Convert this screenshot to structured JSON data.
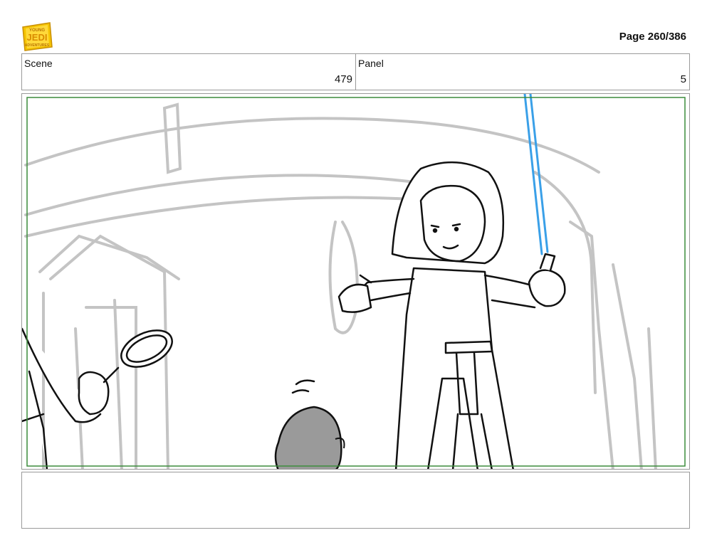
{
  "header": {
    "logo": {
      "icon": "young-jedi-adventures-logo-icon",
      "lines": [
        "YOUNG",
        "JEDI",
        "ADVENTURES"
      ],
      "color": "#f2c200"
    },
    "page_number": "Page 260/386"
  },
  "info": {
    "scene_label": "Scene",
    "scene_value": "479",
    "panel_label": "Panel",
    "panel_value": "5"
  },
  "panel": {
    "description_icons": [
      "sketch-drawing"
    ],
    "safe_frame_color": "#3c8c3c",
    "saber_color": "#3aa0e8"
  },
  "notes": {
    "text": ""
  }
}
